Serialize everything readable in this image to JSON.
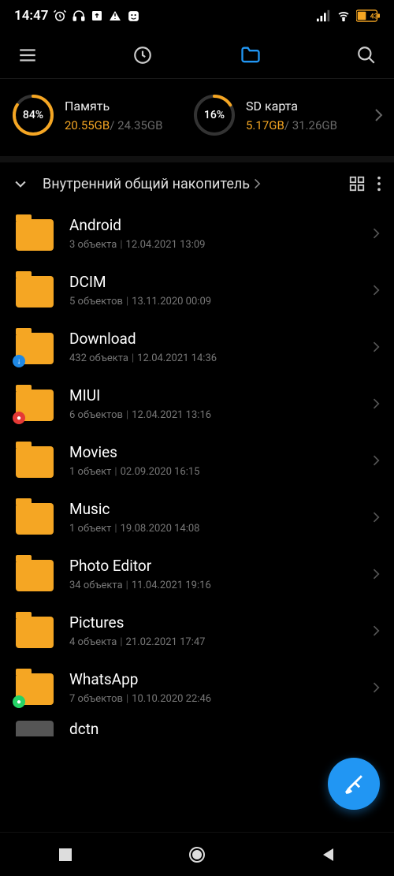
{
  "status": {
    "time": "14:47",
    "battery_icon": "battery-43",
    "battery_pct": "43"
  },
  "storage": {
    "internal": {
      "label": "Память",
      "pct": "84%",
      "pct_num": 84,
      "used": "20.55GB",
      "total": "24.35GB",
      "color": "#f5a623"
    },
    "sd": {
      "label": "SD карта",
      "pct": "16%",
      "pct_num": 16,
      "used": "5.17GB",
      "total": "31.26GB",
      "color": "#f5a623"
    }
  },
  "path": {
    "label": "Внутренний общий накопитель"
  },
  "folders": [
    {
      "name": "Android",
      "sub": "3 объекта",
      "date": "12.04.2021 13:09",
      "badge": null
    },
    {
      "name": "DCIM",
      "sub": "5 объектов",
      "date": "13.11.2020 00:09",
      "badge": null
    },
    {
      "name": "Download",
      "sub": "432 объекта",
      "date": "12.04.2021 14:36",
      "badge": "download"
    },
    {
      "name": "MIUI",
      "sub": "6 объектов",
      "date": "12.04.2021 13:16",
      "badge": "miui"
    },
    {
      "name": "Movies",
      "sub": "1 объект",
      "date": "02.09.2020 16:15",
      "badge": null
    },
    {
      "name": "Music",
      "sub": "1 объект",
      "date": "19.08.2020 14:08",
      "badge": null
    },
    {
      "name": "Photo Editor",
      "sub": "34 объекта",
      "date": "11.04.2021 19:16",
      "badge": null
    },
    {
      "name": "Pictures",
      "sub": "4 объекта",
      "date": "21.02.2021 17:47",
      "badge": null
    },
    {
      "name": "WhatsApp",
      "sub": "7 объектов",
      "date": "10.10.2020 22:46",
      "badge": "whatsapp"
    }
  ],
  "partial_next": {
    "name": "dctn"
  }
}
